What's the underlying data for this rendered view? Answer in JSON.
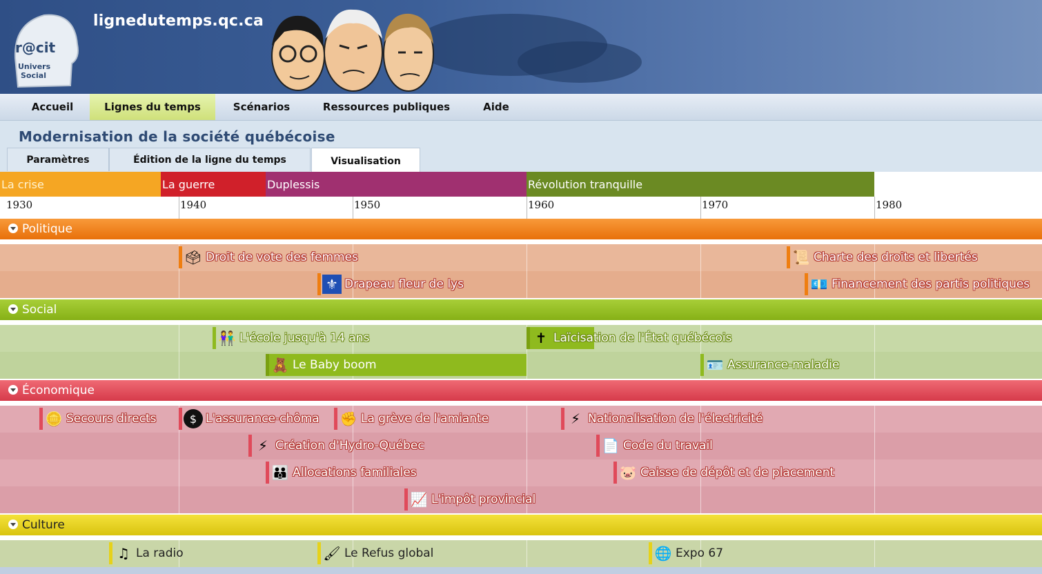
{
  "site": {
    "title": "lignedutemps.qc.ca",
    "logo_top": "r@cit",
    "logo_bottom_1": "Univers",
    "logo_bottom_2": "Social"
  },
  "menu": [
    "Accueil",
    "Lignes du temps",
    "Scénarios",
    "Ressources publiques",
    "Aide"
  ],
  "menu_active": "Lignes du temps",
  "page_title": "Modernisation de la société québécoise",
  "tabs": [
    "Paramètres",
    "Édition de la ligne du temps",
    "Visualisation"
  ],
  "tab_active": "Visualisation",
  "periods": [
    {
      "label": "La crise",
      "color": "#f5a623"
    },
    {
      "label": "La guerre",
      "color": "#d0202a"
    },
    {
      "label": "Duplessis",
      "color": "#a03070"
    },
    {
      "label": "Révolution tranquille",
      "color": "#6b8a23"
    }
  ],
  "years": [
    "1930",
    "1940",
    "1950",
    "1960",
    "1970",
    "1980"
  ],
  "categories": [
    {
      "name": "Politique",
      "color": "#ef7e10",
      "band": "#e9b79a",
      "events": [
        {
          "label": "Droit de vote des femmes",
          "icon": "ballot-box-icon",
          "glyph": "🗳",
          "row": 0
        },
        {
          "label": "Charte des droits et libertés",
          "icon": "scroll-icon",
          "glyph": "📜",
          "row": 0
        },
        {
          "label": "Drapeau fleur de lys",
          "icon": "quebec-flag-icon",
          "glyph": "⚜",
          "row": 1
        },
        {
          "label": "Financement des partis politiques",
          "icon": "money-icon",
          "glyph": "💶",
          "row": 1
        }
      ]
    },
    {
      "name": "Social",
      "color": "#8fba1e",
      "band": "#c7d9a7",
      "events": [
        {
          "label": "L'école jusqu'à 14 ans",
          "icon": "children-icon",
          "glyph": "👫",
          "row": 0
        },
        {
          "label": "Laïcisation de l'État québécois",
          "icon": "cross-icon",
          "glyph": "✝",
          "row": 0
        },
        {
          "label": "Le Baby boom",
          "icon": "teddy-bear-icon",
          "glyph": "🧸",
          "row": 1
        },
        {
          "label": "Assurance-maladie",
          "icon": "health-card-icon",
          "glyph": "🪪",
          "row": 1
        }
      ]
    },
    {
      "name": "Économique",
      "color": "#e04a5a",
      "band": "#e1a9b2",
      "events": [
        {
          "label": "Secours directs",
          "icon": "coins-icon",
          "glyph": "🪙",
          "row": 0
        },
        {
          "label": "L'assurance-chôma",
          "icon": "dollar-coin-icon",
          "glyph": "$",
          "row": 0
        },
        {
          "label": "La grève de l'amiante",
          "icon": "strike-sign-icon",
          "glyph": "✊",
          "row": 0
        },
        {
          "label": "Nationalisation de l'électricité",
          "icon": "lightning-icon",
          "glyph": "⚡",
          "row": 0
        },
        {
          "label": "Création d'Hydro-Québec",
          "icon": "lightning-icon",
          "glyph": "⚡",
          "row": 1
        },
        {
          "label": "Code du travail",
          "icon": "document-icon",
          "glyph": "📄",
          "row": 1
        },
        {
          "label": "Allocations familiales",
          "icon": "family-icon",
          "glyph": "👪",
          "row": 2
        },
        {
          "label": "Caisse de dépôt et de placement",
          "icon": "piggy-bank-icon",
          "glyph": "🐷",
          "row": 2
        },
        {
          "label": "L'impôt provincial",
          "icon": "tax-chart-icon",
          "glyph": "📈",
          "row": 3
        }
      ]
    },
    {
      "name": "Culture",
      "color": "#e6d21a",
      "band": "#c9d6a8",
      "events": [
        {
          "label": "La radio",
          "icon": "music-note-icon",
          "glyph": "♫",
          "row": 0
        },
        {
          "label": "Le Refus global",
          "icon": "paintbrush-icon",
          "glyph": "🖌",
          "row": 0
        },
        {
          "label": "Expo 67",
          "icon": "globe-icon",
          "glyph": "🌐",
          "row": 0
        }
      ]
    }
  ]
}
